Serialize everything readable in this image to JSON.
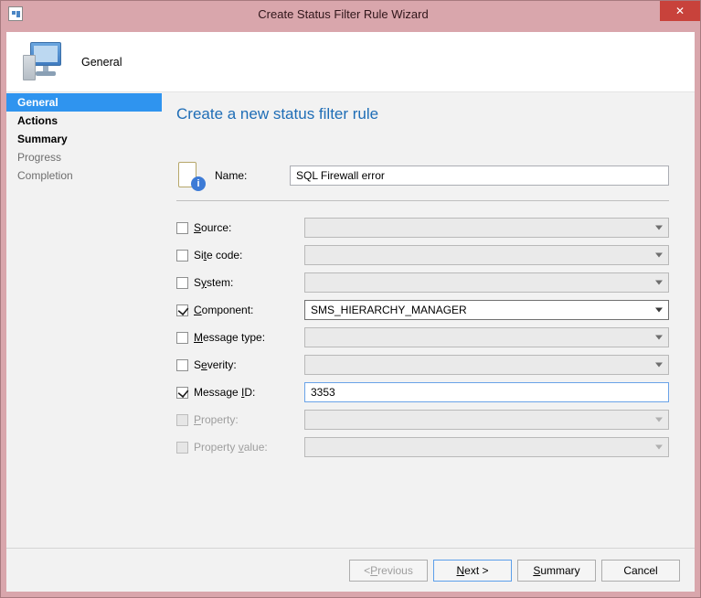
{
  "window": {
    "title": "Create Status Filter Rule Wizard",
    "close_char": "✕"
  },
  "banner": {
    "label": "General"
  },
  "sidebar": {
    "items": [
      {
        "label": "General",
        "selected": true,
        "bold": true
      },
      {
        "label": "Actions",
        "selected": false,
        "bold": true
      },
      {
        "label": "Summary",
        "selected": false,
        "bold": true
      },
      {
        "label": "Progress",
        "selected": false,
        "bold": false
      },
      {
        "label": "Completion",
        "selected": false,
        "bold": false
      }
    ]
  },
  "main": {
    "heading": "Create a new status filter rule",
    "name_label": "Name:",
    "name_value": "SQL Firewall error",
    "fields": {
      "source": {
        "prefix": "",
        "ul": "S",
        "suffix": "ource:"
      },
      "site_code": {
        "prefix": "Si",
        "ul": "t",
        "suffix": "e code:"
      },
      "system": {
        "prefix": "S",
        "ul": "y",
        "suffix": "stem:"
      },
      "component": {
        "prefix": "",
        "ul": "C",
        "suffix": "omponent:",
        "value": "SMS_HIERARCHY_MANAGER"
      },
      "message_type": {
        "prefix": "",
        "ul": "M",
        "suffix": "essage type:"
      },
      "severity": {
        "prefix": "S",
        "ul": "e",
        "suffix": "verity:"
      },
      "message_id": {
        "prefix": "Message ",
        "ul": "I",
        "suffix": "D:",
        "value": "3353"
      },
      "property": {
        "prefix": "",
        "ul": "P",
        "suffix": "roperty:"
      },
      "property_value": {
        "prefix": "Property ",
        "ul": "v",
        "suffix": "alue:"
      }
    }
  },
  "buttons": {
    "previous": {
      "lt": "< ",
      "ul": "P",
      "suffix": "revious"
    },
    "next": {
      "ul": "N",
      "suffix": "ext >"
    },
    "summary": {
      "ul": "S",
      "suffix": "ummary"
    },
    "cancel": {
      "label": "Cancel"
    }
  }
}
